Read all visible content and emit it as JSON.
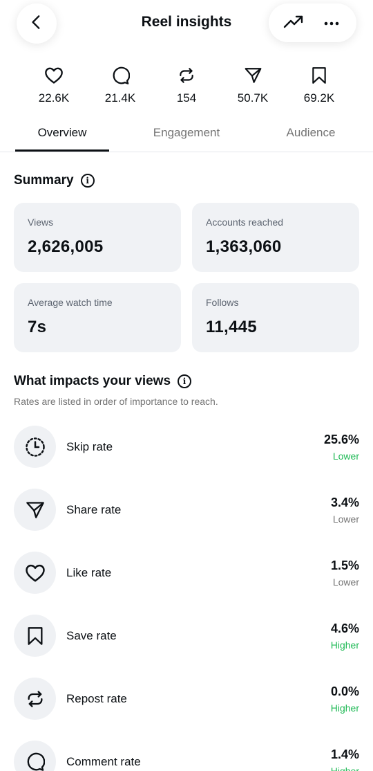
{
  "header": {
    "title": "Reel insights",
    "back_icon": "chevron-left-icon",
    "trend_icon": "trending-up-icon",
    "more_icon": "more-horizontal-icon"
  },
  "stats": [
    {
      "icon": "heart-icon",
      "value": "22.6K"
    },
    {
      "icon": "comment-icon",
      "value": "21.4K"
    },
    {
      "icon": "repost-icon",
      "value": "154"
    },
    {
      "icon": "share-icon",
      "value": "50.7K"
    },
    {
      "icon": "bookmark-icon",
      "value": "69.2K"
    }
  ],
  "tabs": [
    {
      "label": "Overview",
      "active": true
    },
    {
      "label": "Engagement",
      "active": false
    },
    {
      "label": "Audience",
      "active": false
    }
  ],
  "summary": {
    "title": "Summary",
    "cards": [
      {
        "label": "Views",
        "value": "2,626,005"
      },
      {
        "label": "Accounts reached",
        "value": "1,363,060"
      },
      {
        "label": "Average watch time",
        "value": "7s"
      },
      {
        "label": "Follows",
        "value": "11,445"
      }
    ]
  },
  "impacts": {
    "title": "What impacts your views",
    "subtitle": "Rates are listed in order of importance to reach.",
    "rows": [
      {
        "icon": "skip-timer-icon",
        "label": "Skip rate",
        "value": "25.6%",
        "trend": "Lower",
        "trend_color": "#1db954"
      },
      {
        "icon": "share-icon",
        "label": "Share rate",
        "value": "3.4%",
        "trend": "Lower",
        "trend_color": "#737373"
      },
      {
        "icon": "heart-icon",
        "label": "Like rate",
        "value": "1.5%",
        "trend": "Lower",
        "trend_color": "#737373"
      },
      {
        "icon": "bookmark-icon",
        "label": "Save rate",
        "value": "4.6%",
        "trend": "Higher",
        "trend_color": "#1db954"
      },
      {
        "icon": "repost-icon",
        "label": "Repost rate",
        "value": "0.0%",
        "trend": "Higher",
        "trend_color": "#1db954"
      },
      {
        "icon": "comment-icon",
        "label": "Comment rate",
        "value": "1.4%",
        "trend": "Higher",
        "trend_color": "#1db954"
      }
    ]
  },
  "colors": {
    "positive": "#1db954",
    "neutral": "#737373",
    "card_bg": "#f0f2f5"
  }
}
